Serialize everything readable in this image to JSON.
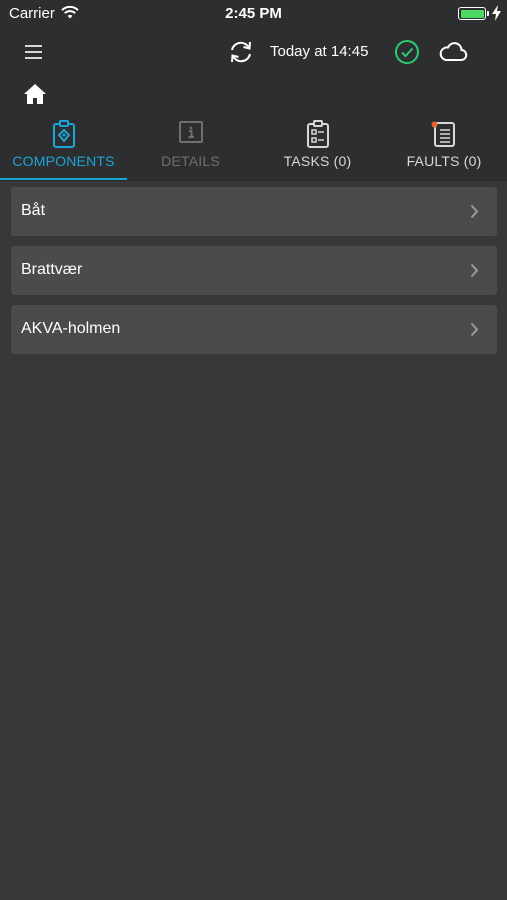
{
  "status_bar": {
    "carrier": "Carrier",
    "time": "2:45 PM",
    "battery_level": 1.0,
    "battery_color": "#4cd964"
  },
  "header": {
    "menu_icon": "hamburger-menu-icon",
    "sync_icon": "sync-icon",
    "sync_time": "Today at 14:45",
    "status_icon": "check-circle-icon",
    "status_color": "#2ecc71",
    "cloud_icon": "cloud-icon",
    "home_icon": "home-icon"
  },
  "tabs": [
    {
      "label": "COMPONENTS",
      "icon": "clipboard-component-icon",
      "state": "active"
    },
    {
      "label": "DETAILS",
      "icon": "info-icon",
      "state": "disabled"
    },
    {
      "label": "TASKS (0)",
      "icon": "checklist-icon",
      "state": "normal"
    },
    {
      "label": "FAULTS (0)",
      "icon": "fault-list-icon",
      "state": "normal"
    }
  ],
  "accent_color": "#1ba5d6",
  "fault_dot_color": "#e8652a",
  "components": [
    {
      "label": "Båt"
    },
    {
      "label": "Brattvær"
    },
    {
      "label": "AKVA-holmen"
    }
  ]
}
